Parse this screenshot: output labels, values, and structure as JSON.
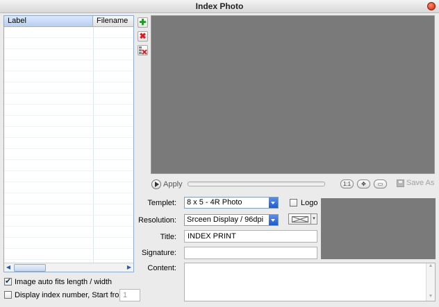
{
  "window": {
    "title": "Index Photo"
  },
  "list": {
    "columns": [
      "Label",
      "Filename"
    ],
    "row_count": 23
  },
  "list_buttons": {
    "add_icon": "plus-icon",
    "delete_icon": "x-icon",
    "delete_all_icon": "delete-all-icon"
  },
  "toolbar": {
    "apply_label": "Apply",
    "actual_size_label": "1:1",
    "save_as_label": "Save As"
  },
  "form": {
    "templet_label": "Templet:",
    "templet_value": "8 x 5 - 4R Photo",
    "logo_label": "Logo",
    "resolution_label": "Resolution:",
    "resolution_value": "Srceen Display / 96dpi",
    "title_label": "Title:",
    "title_value": "INDEX PRINT",
    "signature_label": "Signature:",
    "signature_value": "",
    "content_label": "Content:",
    "content_value": ""
  },
  "options": {
    "auto_fit_label": "Image auto fits length / width",
    "auto_fit_checked": true,
    "display_index_label": "Display index number, Start from",
    "display_index_checked": false,
    "start_from_value": "1"
  },
  "colors": {
    "preview_bg": "#7a7a7a",
    "accent": "#1d5bd0"
  }
}
